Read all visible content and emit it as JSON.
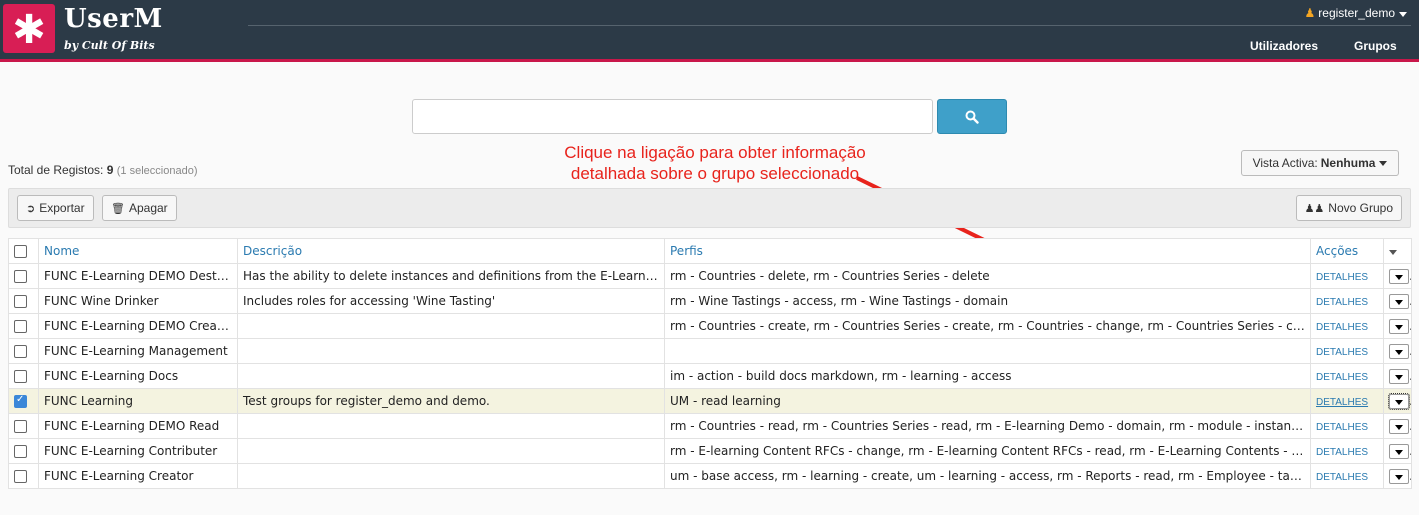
{
  "app": {
    "logo_symbol": "✱",
    "name": "UserM",
    "tagline": "by Cult Of Bits",
    "user": "register_demo",
    "nav": [
      "Utilizadores",
      "Grupos"
    ]
  },
  "search": {
    "placeholder": "",
    "button_icon": "search-icon"
  },
  "annotation": {
    "line1": "Clique na ligação para obter informação",
    "line2": "detalhada sobre o grupo seleccionado",
    "color": "#e8231c"
  },
  "summary": {
    "label": "Total de Registos:",
    "count": "9",
    "selected": "(1 seleccionado)"
  },
  "view": {
    "label": "Vista Activa:",
    "value": "Nenhuma"
  },
  "toolbar": {
    "export": "Exportar",
    "delete": "Apagar",
    "new_group": "Novo Grupo"
  },
  "table": {
    "headers": {
      "name": "Nome",
      "description": "Descrição",
      "profiles": "Perfis",
      "actions": "Acções"
    },
    "details_label": "DETALHES",
    "rows": [
      {
        "name": "FUNC E-Learning DEMO Destroyer",
        "description": "Has the ability to delete instances and definitions from the E-Learning Demo",
        "profiles": "rm - Countries - delete, rm - Countries Series - delete",
        "checked": false
      },
      {
        "name": "FUNC Wine Drinker",
        "description": "Includes roles for accessing 'Wine Tasting'",
        "profiles": "rm - Wine Tastings - access, rm - Wine Tastings - domain",
        "checked": false
      },
      {
        "name": "FUNC E-Learning DEMO Creator",
        "description": "",
        "profiles": "rm - Countries - create, rm - Countries Series - create, rm - Countries - change, rm - Countries Series - change, rm - ...",
        "checked": false
      },
      {
        "name": "FUNC E-Learning Management",
        "description": "",
        "profiles": "",
        "checked": false
      },
      {
        "name": "FUNC E-Learning Docs",
        "description": "",
        "profiles": "im - action - build docs markdown, rm - learning - access",
        "checked": false
      },
      {
        "name": "FUNC Learning",
        "description": "Test groups for register_demo and demo.",
        "profiles": "UM - read learning",
        "checked": true
      },
      {
        "name": "FUNC E-Learning DEMO Read",
        "description": "",
        "profiles": "rm - Countries - read, rm - Countries Series - read, rm - E-learning Demo - domain, rm - module - instance details, rm - ...",
        "checked": false
      },
      {
        "name": "FUNC E-Learning Contributer",
        "description": "",
        "profiles": "rm - E-learning Content RFCs - change, rm - E-learning Content RFCs - read, rm - E-Learning Contents - domain, RM - ...",
        "checked": false
      },
      {
        "name": "FUNC E-Learning Creator",
        "description": "",
        "profiles": "um - base access, rm - learning - create, um - learning - access, rm - Reports - read, rm - Employee - tasks",
        "checked": false
      }
    ]
  }
}
